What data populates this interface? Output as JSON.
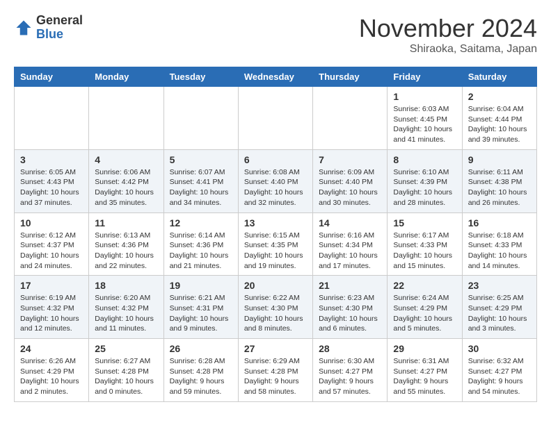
{
  "header": {
    "logo_general": "General",
    "logo_blue": "Blue",
    "month_title": "November 2024",
    "location": "Shiraoka, Saitama, Japan"
  },
  "days_of_week": [
    "Sunday",
    "Monday",
    "Tuesday",
    "Wednesday",
    "Thursday",
    "Friday",
    "Saturday"
  ],
  "weeks": [
    {
      "days": [
        {
          "num": "",
          "info": ""
        },
        {
          "num": "",
          "info": ""
        },
        {
          "num": "",
          "info": ""
        },
        {
          "num": "",
          "info": ""
        },
        {
          "num": "",
          "info": ""
        },
        {
          "num": "1",
          "info": "Sunrise: 6:03 AM\nSunset: 4:45 PM\nDaylight: 10 hours\nand 41 minutes."
        },
        {
          "num": "2",
          "info": "Sunrise: 6:04 AM\nSunset: 4:44 PM\nDaylight: 10 hours\nand 39 minutes."
        }
      ]
    },
    {
      "days": [
        {
          "num": "3",
          "info": "Sunrise: 6:05 AM\nSunset: 4:43 PM\nDaylight: 10 hours\nand 37 minutes."
        },
        {
          "num": "4",
          "info": "Sunrise: 6:06 AM\nSunset: 4:42 PM\nDaylight: 10 hours\nand 35 minutes."
        },
        {
          "num": "5",
          "info": "Sunrise: 6:07 AM\nSunset: 4:41 PM\nDaylight: 10 hours\nand 34 minutes."
        },
        {
          "num": "6",
          "info": "Sunrise: 6:08 AM\nSunset: 4:40 PM\nDaylight: 10 hours\nand 32 minutes."
        },
        {
          "num": "7",
          "info": "Sunrise: 6:09 AM\nSunset: 4:40 PM\nDaylight: 10 hours\nand 30 minutes."
        },
        {
          "num": "8",
          "info": "Sunrise: 6:10 AM\nSunset: 4:39 PM\nDaylight: 10 hours\nand 28 minutes."
        },
        {
          "num": "9",
          "info": "Sunrise: 6:11 AM\nSunset: 4:38 PM\nDaylight: 10 hours\nand 26 minutes."
        }
      ]
    },
    {
      "days": [
        {
          "num": "10",
          "info": "Sunrise: 6:12 AM\nSunset: 4:37 PM\nDaylight: 10 hours\nand 24 minutes."
        },
        {
          "num": "11",
          "info": "Sunrise: 6:13 AM\nSunset: 4:36 PM\nDaylight: 10 hours\nand 22 minutes."
        },
        {
          "num": "12",
          "info": "Sunrise: 6:14 AM\nSunset: 4:36 PM\nDaylight: 10 hours\nand 21 minutes."
        },
        {
          "num": "13",
          "info": "Sunrise: 6:15 AM\nSunset: 4:35 PM\nDaylight: 10 hours\nand 19 minutes."
        },
        {
          "num": "14",
          "info": "Sunrise: 6:16 AM\nSunset: 4:34 PM\nDaylight: 10 hours\nand 17 minutes."
        },
        {
          "num": "15",
          "info": "Sunrise: 6:17 AM\nSunset: 4:33 PM\nDaylight: 10 hours\nand 15 minutes."
        },
        {
          "num": "16",
          "info": "Sunrise: 6:18 AM\nSunset: 4:33 PM\nDaylight: 10 hours\nand 14 minutes."
        }
      ]
    },
    {
      "days": [
        {
          "num": "17",
          "info": "Sunrise: 6:19 AM\nSunset: 4:32 PM\nDaylight: 10 hours\nand 12 minutes."
        },
        {
          "num": "18",
          "info": "Sunrise: 6:20 AM\nSunset: 4:32 PM\nDaylight: 10 hours\nand 11 minutes."
        },
        {
          "num": "19",
          "info": "Sunrise: 6:21 AM\nSunset: 4:31 PM\nDaylight: 10 hours\nand 9 minutes."
        },
        {
          "num": "20",
          "info": "Sunrise: 6:22 AM\nSunset: 4:30 PM\nDaylight: 10 hours\nand 8 minutes."
        },
        {
          "num": "21",
          "info": "Sunrise: 6:23 AM\nSunset: 4:30 PM\nDaylight: 10 hours\nand 6 minutes."
        },
        {
          "num": "22",
          "info": "Sunrise: 6:24 AM\nSunset: 4:29 PM\nDaylight: 10 hours\nand 5 minutes."
        },
        {
          "num": "23",
          "info": "Sunrise: 6:25 AM\nSunset: 4:29 PM\nDaylight: 10 hours\nand 3 minutes."
        }
      ]
    },
    {
      "days": [
        {
          "num": "24",
          "info": "Sunrise: 6:26 AM\nSunset: 4:29 PM\nDaylight: 10 hours\nand 2 minutes."
        },
        {
          "num": "25",
          "info": "Sunrise: 6:27 AM\nSunset: 4:28 PM\nDaylight: 10 hours\nand 0 minutes."
        },
        {
          "num": "26",
          "info": "Sunrise: 6:28 AM\nSunset: 4:28 PM\nDaylight: 9 hours\nand 59 minutes."
        },
        {
          "num": "27",
          "info": "Sunrise: 6:29 AM\nSunset: 4:28 PM\nDaylight: 9 hours\nand 58 minutes."
        },
        {
          "num": "28",
          "info": "Sunrise: 6:30 AM\nSunset: 4:27 PM\nDaylight: 9 hours\nand 57 minutes."
        },
        {
          "num": "29",
          "info": "Sunrise: 6:31 AM\nSunset: 4:27 PM\nDaylight: 9 hours\nand 55 minutes."
        },
        {
          "num": "30",
          "info": "Sunrise: 6:32 AM\nSunset: 4:27 PM\nDaylight: 9 hours\nand 54 minutes."
        }
      ]
    }
  ]
}
